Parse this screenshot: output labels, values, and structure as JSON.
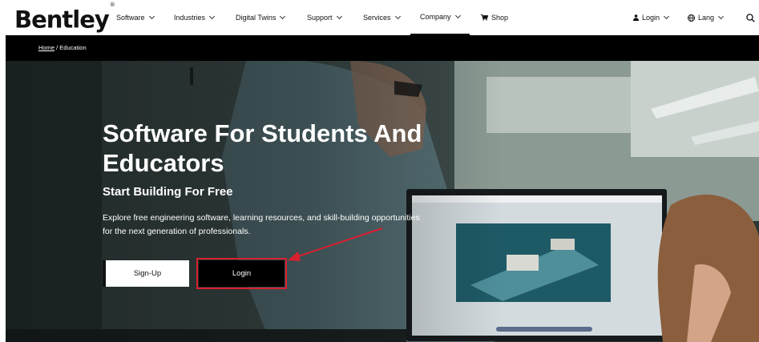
{
  "header": {
    "logo": "Bentley",
    "logo_mark": "®",
    "nav": [
      {
        "label": "Software"
      },
      {
        "label": "Industries"
      },
      {
        "label": "Digital Twins"
      },
      {
        "label": "Support"
      },
      {
        "label": "Services"
      },
      {
        "label": "Company"
      },
      {
        "label": "Shop"
      }
    ],
    "login": "Login",
    "lang": "Lang"
  },
  "breadcrumb": {
    "home": "Home",
    "separator": " / ",
    "current": "Education"
  },
  "hero": {
    "title": "Software For Students And Educators",
    "subtitle": "Start Building For Free",
    "description": "Explore free engineering software, learning resources, and skill-building opportunities for the next generation of professionals.",
    "signup_label": "Sign-Up",
    "login_label": "Login"
  },
  "icons": {
    "nav_chevron": "chevron-down-icon",
    "shop": "cart-icon",
    "login": "user-icon",
    "lang": "globe-icon",
    "search": "search-icon"
  },
  "colors": {
    "highlight": "#d8202f",
    "breadcrumb_bg": "#000000",
    "active_underline": "#111111"
  }
}
